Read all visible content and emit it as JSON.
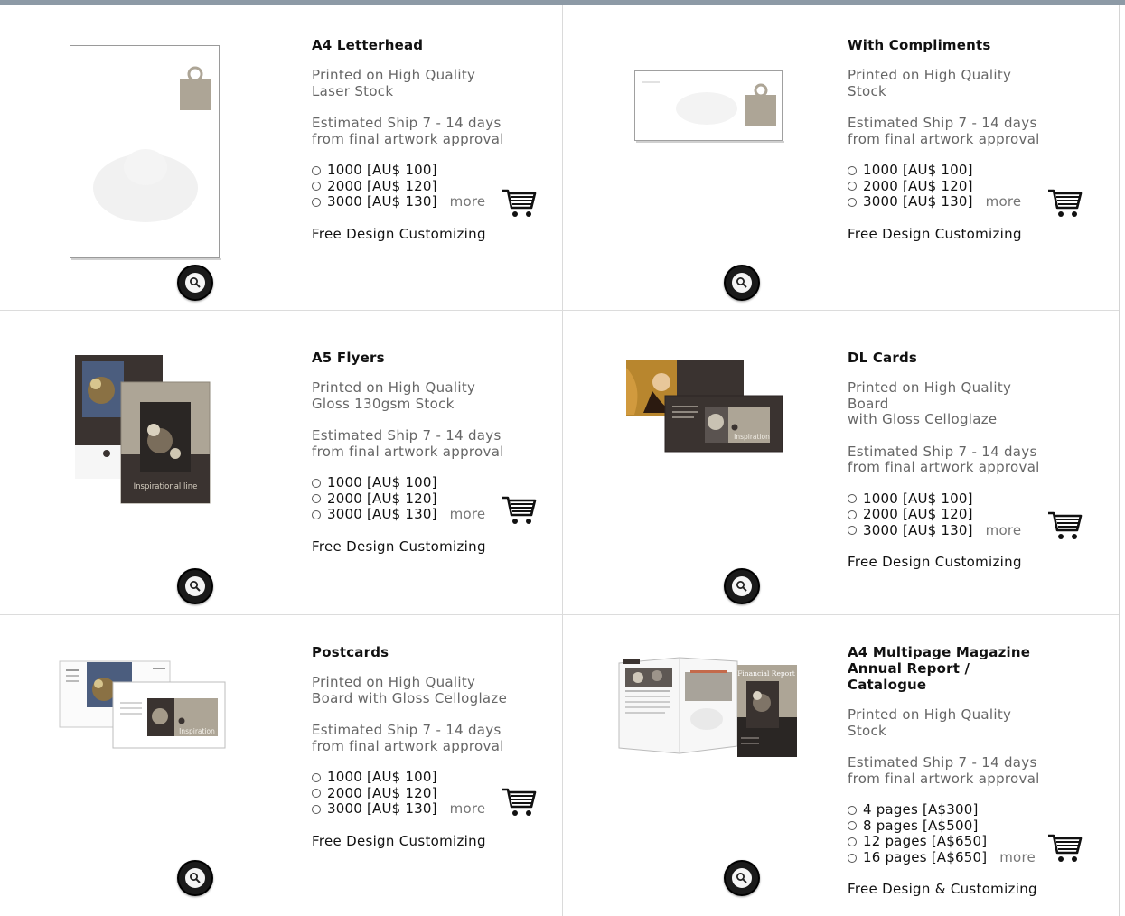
{
  "products": [
    {
      "title": "A4 Letterhead",
      "desc": [
        "Printed on High Quality",
        "Laser Stock"
      ],
      "ship": [
        "Estimated Ship 7 - 14 days",
        "from final artwork approval"
      ],
      "options": [
        "1000 [AU$ 100]",
        "2000 [AU$ 120]",
        "3000 [AU$ 130]"
      ],
      "more": "more",
      "free": "Free Design Customizing"
    },
    {
      "title": "With Compliments",
      "desc": [
        "Printed on High Quality",
        "Stock"
      ],
      "ship": [
        "Estimated Ship 7 - 14 days",
        "from final artwork approval"
      ],
      "options": [
        "1000 [AU$ 100]",
        "2000 [AU$ 120]",
        "3000 [AU$ 130]"
      ],
      "more": "more",
      "free": "Free Design Customizing"
    },
    {
      "title": "A5 Flyers",
      "desc": [
        "Printed on High Quality",
        "Gloss 130gsm Stock"
      ],
      "ship": [
        "Estimated Ship 7 - 14 days",
        "from final artwork approval"
      ],
      "options": [
        "1000 [AU$ 100]",
        "2000 [AU$ 120]",
        "3000 [AU$ 130]"
      ],
      "more": "more",
      "free": "Free Design Customizing",
      "thumb_text": "Inspirational line"
    },
    {
      "title": "DL Cards",
      "desc": [
        "Printed on High Quality",
        "Board",
        "with Gloss Celloglaze"
      ],
      "ship": [
        "Estimated Ship 7 - 14 days",
        "from final artwork approval"
      ],
      "options": [
        "1000 [AU$ 100]",
        "2000 [AU$ 120]",
        "3000 [AU$ 130]"
      ],
      "more": "more",
      "free": "Free Design Customizing",
      "thumb_text": "Inspiration"
    },
    {
      "title": "Postcards",
      "desc": [
        "Printed on High Quality",
        "Board with Gloss Celloglaze"
      ],
      "ship": [
        "Estimated Ship 7 - 14 days",
        "from final artwork approval"
      ],
      "options": [
        "1000 [AU$ 100]",
        "2000 [AU$ 120]",
        "3000 [AU$ 130]"
      ],
      "more": "more",
      "free": "Free Design Customizing",
      "thumb_text": "Inspiration"
    },
    {
      "title": "A4 Multipage Magazine Annual Report / Catalogue",
      "title_lines": [
        "A4 Multipage Magazine",
        "Annual Report /",
        "Catalogue"
      ],
      "desc": [
        "Printed on High Quality",
        "Stock"
      ],
      "ship": [
        "Estimated Ship 7 - 14 days",
        "from final artwork approval"
      ],
      "options": [
        "4 pages [A$300]",
        "8 pages [A$500]",
        "12 pages [A$650]",
        "16 pages [A$650]"
      ],
      "more": "more",
      "free": "Free Design & Customizing",
      "thumb_text": "Financial Report"
    }
  ],
  "colors": {
    "top_bar": "#8d9aa6",
    "divider": "#dcdcdc",
    "muted_text": "#666666",
    "zoom_button": "#1a1a1a",
    "card_dark": "#3a3330",
    "card_beige": "#ada596"
  },
  "icons": {
    "zoom": "magnifier-icon",
    "cart": "shopping-cart-icon",
    "radio": "radio-button"
  }
}
